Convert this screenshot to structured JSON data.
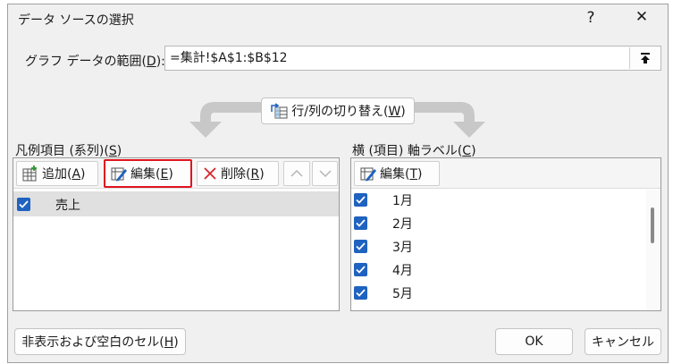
{
  "dialog": {
    "title": "データ ソースの選択",
    "help_glyph": "?",
    "close_glyph": "✕"
  },
  "range": {
    "label": "グラフ データの範囲(",
    "label_key": "D",
    "label_tail": "):",
    "value": "=集計!$A$1:$B$12",
    "collapse_icon": "collapse-range-icon"
  },
  "switch_button": {
    "label": "行/列の切り替え(",
    "key": "W",
    "tail": ")",
    "icon": "switch-row-column-icon"
  },
  "legend_panel": {
    "label": "凡例項目 (系列)(",
    "key": "S",
    "tail": ")",
    "add": {
      "label": "追加(",
      "key": "A",
      "tail": ")",
      "icon": "add-table-icon"
    },
    "edit": {
      "label": "編集(",
      "key": "E",
      "tail": ")",
      "icon": "edit-pencil-icon"
    },
    "delete": {
      "label": "削除(",
      "key": "R",
      "tail": ")",
      "icon": "delete-x-icon"
    },
    "up_icon": "chevron-up-icon",
    "down_icon": "chevron-down-icon",
    "series": [
      {
        "name": "売上",
        "checked": true,
        "selected": true
      }
    ]
  },
  "axis_panel": {
    "label": "横 (項目) 軸ラベル(",
    "key": "C",
    "tail": ")",
    "edit": {
      "label": "編集(",
      "key": "T",
      "tail": ")",
      "icon": "edit-pencil-icon"
    },
    "items": [
      {
        "label": "1月",
        "checked": true
      },
      {
        "label": "2月",
        "checked": true
      },
      {
        "label": "3月",
        "checked": true
      },
      {
        "label": "4月",
        "checked": true
      },
      {
        "label": "5月",
        "checked": true
      }
    ]
  },
  "footer": {
    "hidden_cells": {
      "label": "非表示および空白のセル(",
      "key": "H",
      "tail": ")"
    },
    "ok": "OK",
    "cancel": "キャンセル"
  },
  "colors": {
    "accent": "#1f62c0",
    "focus_border": "#e0141e",
    "selected_row": "#e0e0e0"
  }
}
